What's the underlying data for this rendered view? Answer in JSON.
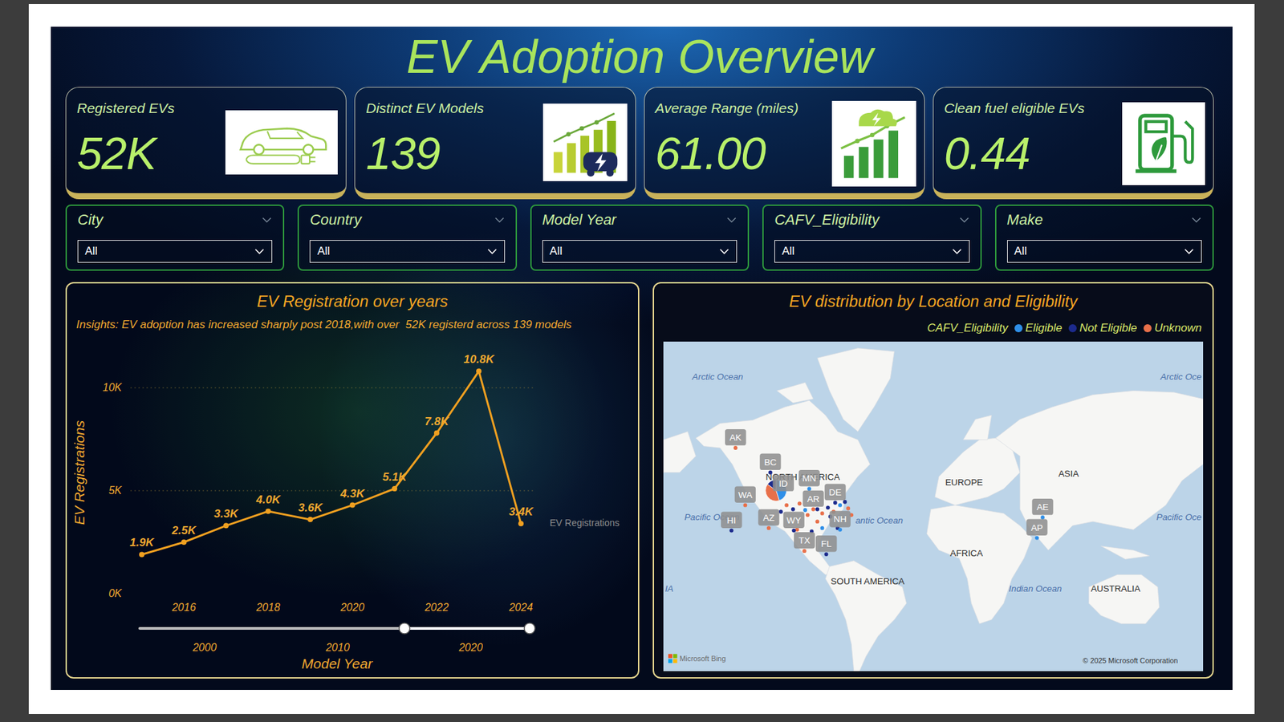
{
  "title": "EV Adoption Overview",
  "kpis": [
    {
      "label": "Registered EVs",
      "value": "52K",
      "kind": "car"
    },
    {
      "label": "Distinct EV Models",
      "value": "139",
      "kind": "models"
    },
    {
      "label": "Average Range (miles)",
      "value": "61.00",
      "kind": "range"
    },
    {
      "label": "Clean fuel eligible EVs",
      "value": "0.44",
      "kind": "fuel"
    }
  ],
  "slicers": [
    {
      "label": "City",
      "value": "All"
    },
    {
      "label": "Country",
      "value": "All"
    },
    {
      "label": "Model Year",
      "value": "All"
    },
    {
      "label": "CAFV_Eligibility",
      "value": "All"
    },
    {
      "label": "Make",
      "value": "All"
    }
  ],
  "line_chart": {
    "title": "EV Registration over years",
    "insight": "Insights: EV adoption has increased sharply post 2018,with over  52K registerd across 139 models",
    "y_axis_title": "EV Registrations",
    "x_axis_title": "Model Year",
    "y_ticks": [
      "10K",
      "5K",
      "0K"
    ],
    "x_ticks": [
      "2016",
      "2018",
      "2020",
      "2022",
      "2024"
    ],
    "series": {
      "name": "EV Registrations",
      "values": [
        1900,
        2500,
        3300,
        4000,
        3600,
        4300,
        5100,
        7800,
        10800,
        3400
      ],
      "labels": [
        "1.9K",
        "2.5K",
        "3.3K",
        "4.0K",
        "3.6K",
        "4.3K",
        "5.1K",
        "7.8K",
        "10.8K",
        "3.4K"
      ]
    },
    "slider": {
      "ticks": [
        "2000",
        "2010",
        "2020"
      ],
      "level_start": 0.68,
      "level_end": 1.0
    }
  },
  "map_panel": {
    "title": "EV distribution by Location and Eligibility",
    "legend_title": "CAFV_Eligibility",
    "legend": [
      {
        "label": "Eligible",
        "color": "#2f8fe8"
      },
      {
        "label": "Not Eligible",
        "color": "#1c2a8c"
      },
      {
        "label": "Unknown",
        "color": "#e8704a"
      }
    ],
    "ocean_labels": [
      "Arctic Ocean",
      "Arctic Oce",
      "Pacific Ocean",
      "antic Ocean",
      "Pacific Oce",
      "Indian Ocean",
      "IA"
    ],
    "continent_labels": [
      "NORTH AMERICA",
      "EUROPE",
      "ASIA",
      "AFRICA",
      "SOUTH AMERICA",
      "AUSTRALIA"
    ],
    "locations": [
      {
        "label": "AK",
        "color": "#e8704a"
      },
      {
        "label": "BC",
        "color": "#1c2a8c"
      },
      {
        "label": "WA",
        "color": "#e8704a"
      },
      {
        "label": "ID",
        "color": "#1c2a8c"
      },
      {
        "label": "MN",
        "color": "#2f8fe8"
      },
      {
        "label": "AR",
        "color": "#e8704a"
      },
      {
        "label": "DE",
        "color": "#1c2a8c"
      },
      {
        "label": "AZ",
        "color": "#e8704a"
      },
      {
        "label": "WY",
        "color": "#1c2a8c"
      },
      {
        "label": "NH",
        "color": "#2f8fe8"
      },
      {
        "label": "TX",
        "color": "#e8704a"
      },
      {
        "label": "FL",
        "color": "#1c2a8c"
      },
      {
        "label": "HI",
        "color": "#1c2a8c"
      },
      {
        "label": "AE",
        "color": "#2f8fe8"
      },
      {
        "label": "AP",
        "color": "#2f8fe8"
      }
    ],
    "cluster_points": [
      "#e8704a",
      "#1c2a8c",
      "#e8704a",
      "#2f8fe8",
      "#1c2a8c",
      "#e8704a",
      "#1c2a8c",
      "#e8704a",
      "#2f8fe8",
      "#1c2a8c",
      "#e8704a",
      "#1c2a8c",
      "#e8704a",
      "#1c2a8c",
      "#e8704a",
      "#2f8fe8",
      "#1c2a8c",
      "#e8704a",
      "#1c2a8c",
      "#e8704a"
    ],
    "pie": [
      {
        "share": 0.45,
        "color": "#2f8fe8"
      },
      {
        "share": 0.4,
        "color": "#e8704a"
      },
      {
        "share": 0.15,
        "color": "#1c2a8c"
      }
    ],
    "provider": "Microsoft Bing",
    "copyright": "© 2025 Microsoft Corporation"
  }
}
